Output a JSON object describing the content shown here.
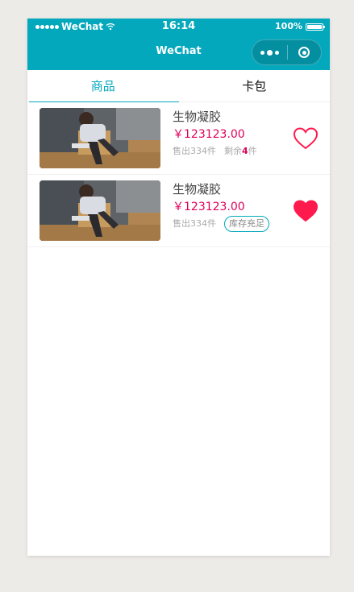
{
  "status_bar": {
    "carrier": "WeChat",
    "time": "16:14",
    "battery": "100%"
  },
  "nav": {
    "title": "WeChat"
  },
  "tabs": [
    {
      "label": "商品",
      "active": true
    },
    {
      "label": "卡包",
      "active": false
    }
  ],
  "products": [
    {
      "name": "生物凝胶",
      "price": "￥123123.00",
      "sold": "售出334件",
      "remain_prefix": "剩余",
      "remain_count": "4",
      "remain_suffix": "件",
      "favorited": false
    },
    {
      "name": "生物凝胶",
      "price": "￥123123.00",
      "sold": "售出334件",
      "stock_badge": "库存充足",
      "favorited": true
    }
  ],
  "colors": {
    "accent": "#04a8bd",
    "price": "#e0005b",
    "heart": "#ff1a4e"
  },
  "icons": {
    "wifi": "wifi-icon",
    "battery": "battery-icon",
    "more": "more-dots-icon",
    "close": "close-circle-icon",
    "favorite_outline": "heart-outline-icon",
    "favorite_filled": "heart-filled-icon"
  }
}
